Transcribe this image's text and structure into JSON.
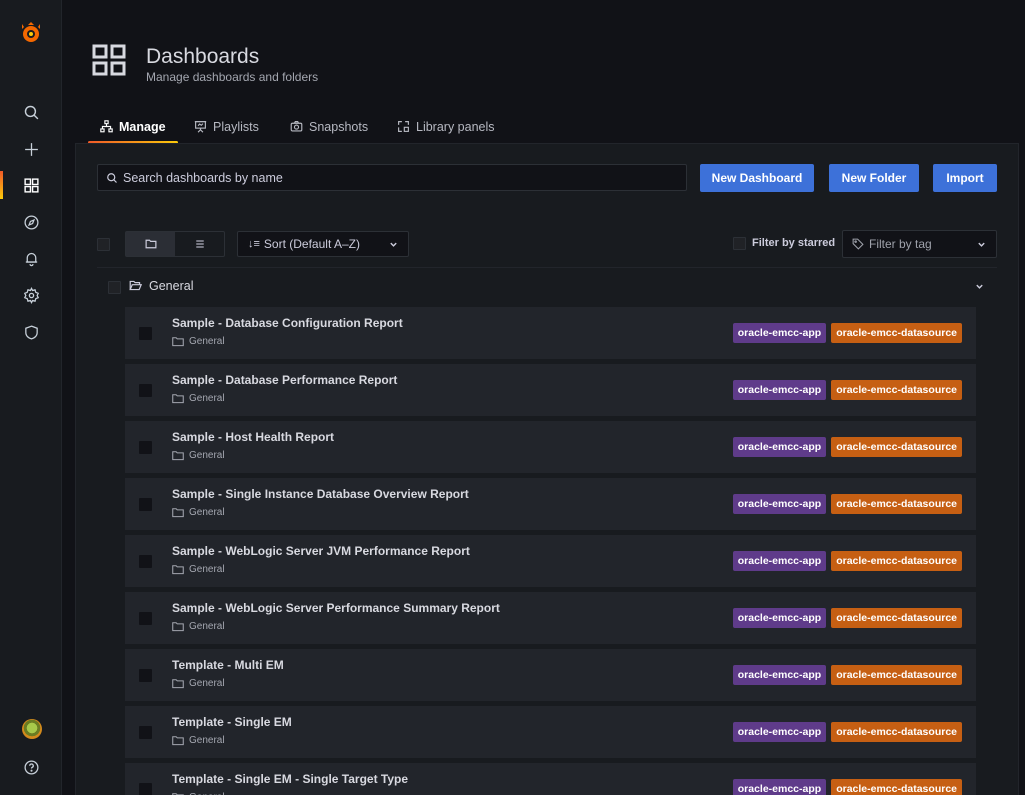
{
  "header": {
    "title": "Dashboards",
    "subtitle": "Manage dashboards and folders"
  },
  "tabs": [
    {
      "label": "Manage",
      "icon": "sitemap-icon",
      "active": true
    },
    {
      "label": "Playlists",
      "icon": "presentation-icon",
      "active": false
    },
    {
      "label": "Snapshots",
      "icon": "camera-icon",
      "active": false
    },
    {
      "label": "Library panels",
      "icon": "library-panel-icon",
      "active": false
    }
  ],
  "search": {
    "placeholder": "Search dashboards by name"
  },
  "actions": {
    "new_dashboard": "New Dashboard",
    "new_folder": "New Folder",
    "import": "Import"
  },
  "toolbar": {
    "sort_label": "Sort (Default A–Z)",
    "filter_starred_label": "Filter by starred",
    "filter_tag_placeholder": "Filter by tag"
  },
  "folder": {
    "name": "General"
  },
  "tag_colors": {
    "oracle-emcc-app": "#5f3b8a",
    "oracle-emcc-datasource": "#c65f13"
  },
  "accent": "#3d71d9",
  "dashboards": [
    {
      "title": "Sample - Database Configuration Report",
      "folder": "General",
      "tags": [
        "oracle-emcc-app",
        "oracle-emcc-datasource"
      ]
    },
    {
      "title": "Sample - Database Performance Report",
      "folder": "General",
      "tags": [
        "oracle-emcc-app",
        "oracle-emcc-datasource"
      ]
    },
    {
      "title": "Sample - Host Health Report",
      "folder": "General",
      "tags": [
        "oracle-emcc-app",
        "oracle-emcc-datasource"
      ]
    },
    {
      "title": "Sample - Single Instance Database Overview Report",
      "folder": "General",
      "tags": [
        "oracle-emcc-app",
        "oracle-emcc-datasource"
      ]
    },
    {
      "title": "Sample - WebLogic Server JVM Performance Report",
      "folder": "General",
      "tags": [
        "oracle-emcc-app",
        "oracle-emcc-datasource"
      ]
    },
    {
      "title": "Sample - WebLogic Server Performance Summary Report",
      "folder": "General",
      "tags": [
        "oracle-emcc-app",
        "oracle-emcc-datasource"
      ]
    },
    {
      "title": "Template - Multi EM",
      "folder": "General",
      "tags": [
        "oracle-emcc-app",
        "oracle-emcc-datasource"
      ]
    },
    {
      "title": "Template - Single EM",
      "folder": "General",
      "tags": [
        "oracle-emcc-app",
        "oracle-emcc-datasource"
      ]
    },
    {
      "title": "Template - Single EM - Single Target Type",
      "folder": "General",
      "tags": [
        "oracle-emcc-app",
        "oracle-emcc-datasource"
      ]
    }
  ]
}
